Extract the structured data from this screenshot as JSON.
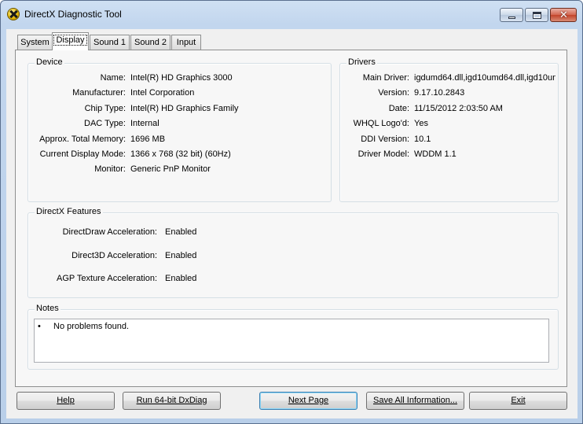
{
  "window": {
    "title": "DirectX Diagnostic Tool"
  },
  "tabs": [
    {
      "label": "System"
    },
    {
      "label": "Display"
    },
    {
      "label": "Sound 1"
    },
    {
      "label": "Sound 2"
    },
    {
      "label": "Input"
    }
  ],
  "device": {
    "title": "Device",
    "rows": [
      {
        "label": "Name:",
        "value": "Intel(R) HD Graphics 3000"
      },
      {
        "label": "Manufacturer:",
        "value": "Intel Corporation"
      },
      {
        "label": "Chip Type:",
        "value": "Intel(R) HD Graphics Family"
      },
      {
        "label": "DAC Type:",
        "value": "Internal"
      },
      {
        "label": "Approx. Total Memory:",
        "value": "1696 MB"
      },
      {
        "label": "Current Display Mode:",
        "value": "1366 x 768 (32 bit) (60Hz)"
      },
      {
        "label": "Monitor:",
        "value": "Generic PnP Monitor"
      }
    ]
  },
  "drivers": {
    "title": "Drivers",
    "rows": [
      {
        "label": "Main Driver:",
        "value": "igdumd64.dll,igd10umd64.dll,igd10um"
      },
      {
        "label": "Version:",
        "value": "9.17.10.2843"
      },
      {
        "label": "Date:",
        "value": "11/15/2012 2:03:50 AM"
      },
      {
        "label": "WHQL Logo'd:",
        "value": "Yes"
      },
      {
        "label": "DDI Version:",
        "value": "10.1"
      },
      {
        "label": "Driver Model:",
        "value": "WDDM 1.1"
      }
    ]
  },
  "features": {
    "title": "DirectX Features",
    "rows": [
      {
        "label": "DirectDraw Acceleration:",
        "value": "Enabled"
      },
      {
        "label": "Direct3D Acceleration:",
        "value": "Enabled"
      },
      {
        "label": "AGP Texture Acceleration:",
        "value": "Enabled"
      }
    ]
  },
  "notes": {
    "title": "Notes",
    "bullet": "•",
    "items": [
      "No problems found."
    ]
  },
  "buttons": {
    "help": "Help",
    "run64": "Run 64-bit DxDiag",
    "next": "Next Page",
    "save": "Save All Information...",
    "exit": "Exit"
  }
}
